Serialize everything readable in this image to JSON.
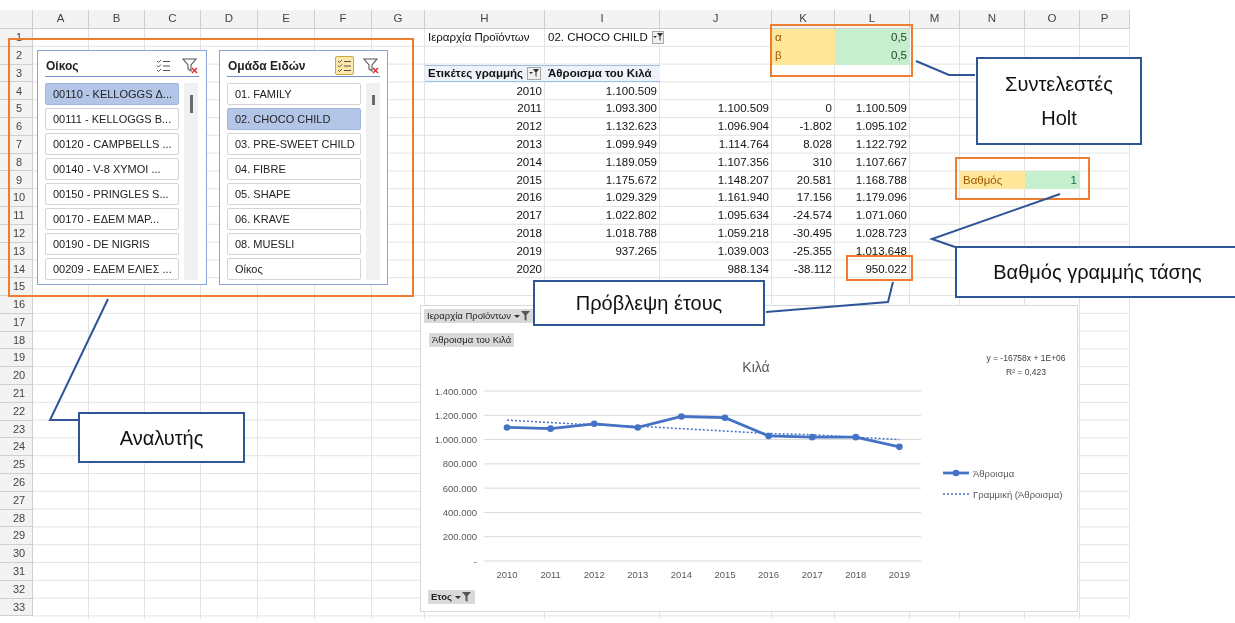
{
  "sheet": {
    "columns": [
      "A",
      "B",
      "C",
      "D",
      "E",
      "F",
      "G",
      "H",
      "I",
      "J",
      "K",
      "L",
      "M",
      "N",
      "O",
      "P"
    ],
    "rows": [
      "1",
      "2",
      "3",
      "4",
      "5",
      "6",
      "7",
      "8",
      "9",
      "10",
      "11",
      "12",
      "13",
      "14",
      "15",
      "16",
      "17",
      "18",
      "19",
      "20",
      "21",
      "22",
      "23",
      "24",
      "25",
      "26",
      "27",
      "28",
      "29",
      "30",
      "31",
      "32",
      "33"
    ]
  },
  "slicers": [
    {
      "title": "Οίκος",
      "multi_select": false,
      "items": [
        {
          "label": "00110 - KELLOGGS Δ...",
          "selected": true
        },
        {
          "label": "00111 - KELLOGGS B...",
          "selected": false
        },
        {
          "label": "00120 - CAMPBELLS ...",
          "selected": false
        },
        {
          "label": "00140 - V-8 XYMOI ...",
          "selected": false
        },
        {
          "label": "00150 - PRINGLES S...",
          "selected": false
        },
        {
          "label": "00170 - ΕΔΕΜ ΜΑΡ...",
          "selected": false
        },
        {
          "label": "00190 - DE NIGRIS",
          "selected": false
        },
        {
          "label": "00209 - ΕΔΕΜ ΕΛΙΕΣ ...",
          "selected": false
        }
      ]
    },
    {
      "title": "Ομάδα Ειδών",
      "multi_select": true,
      "items": [
        {
          "label": "01. FAMILY",
          "selected": false
        },
        {
          "label": "02. CHOCO CHILD",
          "selected": true
        },
        {
          "label": "03. PRE-SWEET CHILD",
          "selected": false
        },
        {
          "label": "04. FIBRE",
          "selected": false
        },
        {
          "label": "05. SHAPE",
          "selected": false
        },
        {
          "label": "06. KRAVE",
          "selected": false
        },
        {
          "label": "08. MUESLI",
          "selected": false
        },
        {
          "label": "Οίκος",
          "selected": false
        }
      ]
    }
  ],
  "pivot_table": {
    "filter_label": "Ιεραρχία Προϊόντων",
    "filter_value": "02. CHOCO CHILD",
    "row_header": "Ετικέτες γραμμής",
    "value_header": "Άθροισμα του Κιλά",
    "rows": [
      {
        "label": "2010",
        "sum": "1.100.509"
      },
      {
        "label": "2011",
        "sum": "1.093.300",
        "column_j": "1.100.509",
        "column_k": "0",
        "column_l": "1.100.509"
      },
      {
        "label": "2012",
        "sum": "1.132.623",
        "column_j": "1.096.904",
        "column_k": "-1.802",
        "column_l": "1.095.102"
      },
      {
        "label": "2013",
        "sum": "1.099.949",
        "column_j": "1.114.764",
        "column_k": "8.028",
        "column_l": "1.122.792"
      },
      {
        "label": "2014",
        "sum": "1.189.059",
        "column_j": "1.107.356",
        "column_k": "310",
        "column_l": "1.107.667"
      },
      {
        "label": "2015",
        "sum": "1.175.672",
        "column_j": "1.148.207",
        "column_k": "20.581",
        "column_l": "1.168.788"
      },
      {
        "label": "2016",
        "sum": "1.029.329",
        "column_j": "1.161.940",
        "column_k": "17.156",
        "column_l": "1.179.096"
      },
      {
        "label": "2017",
        "sum": "1.022.802",
        "column_j": "1.095.634",
        "column_k": "-24.574",
        "column_l": "1.071.060"
      },
      {
        "label": "2018",
        "sum": "1.018.788",
        "column_j": "1.059.218",
        "column_k": "-30.495",
        "column_l": "1.028.723"
      },
      {
        "label": "2019",
        "sum": "937.265",
        "column_j": "1.039.003",
        "column_k": "-25.355",
        "column_l": "1.013.648"
      },
      {
        "label": "2020",
        "column_j": "988.134",
        "column_k": "-38.112",
        "column_l": "950.022"
      }
    ]
  },
  "holt_parameters": [
    {
      "label": "α",
      "value": "0,5"
    },
    {
      "label": "β",
      "value": "0,5"
    }
  ],
  "trend_degree": {
    "label": "Βαθμός",
    "value": "1"
  },
  "callouts": [
    {
      "kind": "analyzer",
      "text": "Αναλυτής"
    },
    {
      "kind": "holt",
      "text": "Συντελεστές Holt"
    },
    {
      "kind": "degree",
      "text": "Βαθμός γραμμής τάσης"
    },
    {
      "kind": "forecast",
      "text": "Πρόβλεψη έτους"
    }
  ],
  "chart": {
    "field_buttons": [
      {
        "kind": "filter",
        "label": "Ιεραρχία Προϊόντων"
      },
      {
        "kind": "value",
        "label": "Άθροισμα του Κιλά"
      },
      {
        "kind": "axis",
        "label": "Ετος"
      }
    ],
    "chart_data": {
      "type": "line",
      "title": "Κιλά",
      "categories": [
        "2010",
        "2011",
        "2012",
        "2013",
        "2014",
        "2015",
        "2016",
        "2017",
        "2018",
        "2019"
      ],
      "series": [
        {
          "name": "Άθροισμα",
          "color": "#4472c4",
          "marker": "circle",
          "line_style": "solid",
          "values": [
            1100000,
            1090000,
            1130000,
            1100000,
            1190000,
            1180000,
            1030000,
            1020000,
            1020000,
            940000
          ]
        },
        {
          "name": "Γραμμική (Άθροισμα)",
          "color": "#4472c4",
          "line_style": "dotted",
          "values": [
            1160000,
            1140000,
            1120000,
            1110000,
            1090000,
            1070000,
            1050000,
            1040000,
            1020000,
            1000000
          ]
        }
      ],
      "grid": true,
      "legend": true,
      "ylim": [
        0,
        1400000
      ],
      "yticks": [
        {
          "value": 0,
          "label": "-"
        },
        {
          "value": 200000,
          "label": "200.000"
        },
        {
          "value": 400000,
          "label": "400.000"
        },
        {
          "value": 600000,
          "label": "600.000"
        },
        {
          "value": 800000,
          "label": "800.000"
        },
        {
          "value": 1000000,
          "label": "1.000.000"
        },
        {
          "value": 1200000,
          "label": "1.200.000"
        },
        {
          "value": 1400000,
          "label": "1.400.000"
        }
      ],
      "annotations": [
        "y = -16758x + 1E+06",
        "R² = 0,423"
      ]
    }
  }
}
